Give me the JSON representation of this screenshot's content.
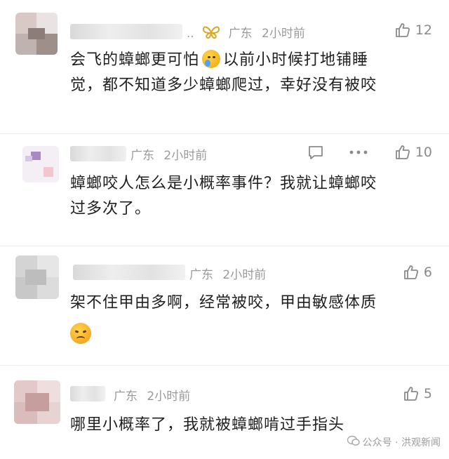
{
  "comments": [
    {
      "location": "广东",
      "time": "2小时前",
      "likes": "12",
      "text_line1": "会飞的蟑螂更可怕",
      "text_line1b": "以前小时候打地铺睡",
      "text_line2": "觉，都不知道多少蟑螂爬过，幸好没有被咬",
      "badge_icon": "butterfly-icon",
      "emoji_icon": "crying-face-icon"
    },
    {
      "location": "广东",
      "time": "2小时前",
      "likes": "10",
      "text_line1": "蟑螂咬人怎么是小概率事件？我就让蟑螂咬",
      "text_line2": "过多次了。"
    },
    {
      "location": "广东",
      "time": "2小时前",
      "likes": "6",
      "text_line1": "架不住甲由多啊，经常被咬，甲由敏感体质",
      "emoji_icon": "sad-face-icon"
    },
    {
      "location": "广东",
      "time": "2小时前",
      "likes": "5",
      "text_line1": "哪里小概率了，我就被蟑螂啃过手指头"
    }
  ],
  "watermark": {
    "text": "公众号 · 洪观新闻"
  },
  "colors": {
    "text": "#1f1f1f",
    "meta": "#9a9a9a",
    "butterfly": "#d9a62a",
    "divider": "#ececec"
  }
}
